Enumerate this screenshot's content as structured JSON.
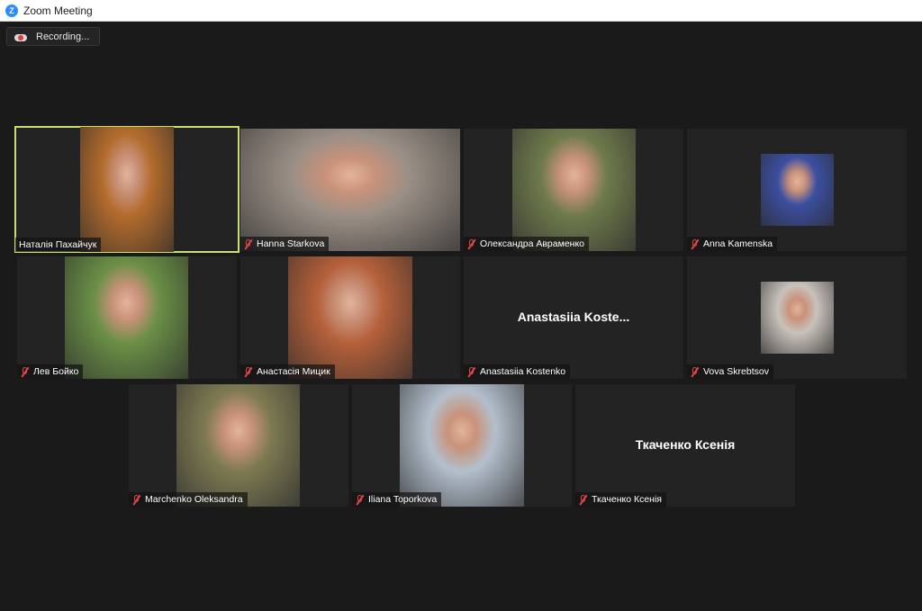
{
  "window": {
    "title": "Zoom Meeting",
    "logo_letter": "Z"
  },
  "recording": {
    "label": "Recording..."
  },
  "participants": [
    {
      "name": "Наталія Пахайчук",
      "muted": false,
      "active": true,
      "video": true,
      "bg": "#b36b2c"
    },
    {
      "name": "Hanna Starkova",
      "muted": true,
      "active": false,
      "video": true,
      "bg": "#9a8f86"
    },
    {
      "name": "Олександра Авраменко",
      "muted": true,
      "active": false,
      "video": true,
      "bg": "#6e7a4c"
    },
    {
      "name": "Anna Kamenska",
      "muted": true,
      "active": false,
      "video": true,
      "bg": "#3b4fa0"
    },
    {
      "name": "Лев Бойко",
      "muted": true,
      "active": false,
      "video": true,
      "bg": "#6a8f46"
    },
    {
      "name": "Анастасія Мицик",
      "muted": true,
      "active": false,
      "video": true,
      "bg": "#b5603a"
    },
    {
      "name": "Anastasiia Kostenko",
      "display_name": "Anastasiia  Koste...",
      "muted": true,
      "active": false,
      "video": false
    },
    {
      "name": "Vova Skrebtsov",
      "muted": true,
      "active": false,
      "video": true,
      "bg": "#c8c2bb"
    },
    {
      "name": "Marchenko Oleksandra",
      "muted": true,
      "active": false,
      "video": true,
      "bg": "#7d7a52"
    },
    {
      "name": "Iliana Toporkova",
      "muted": true,
      "active": false,
      "video": true,
      "bg": "#b3bfcc"
    },
    {
      "name": "Ткаченко Ксенія",
      "display_name": "Ткаченко Ксенія",
      "muted": true,
      "active": false,
      "video": false
    }
  ]
}
